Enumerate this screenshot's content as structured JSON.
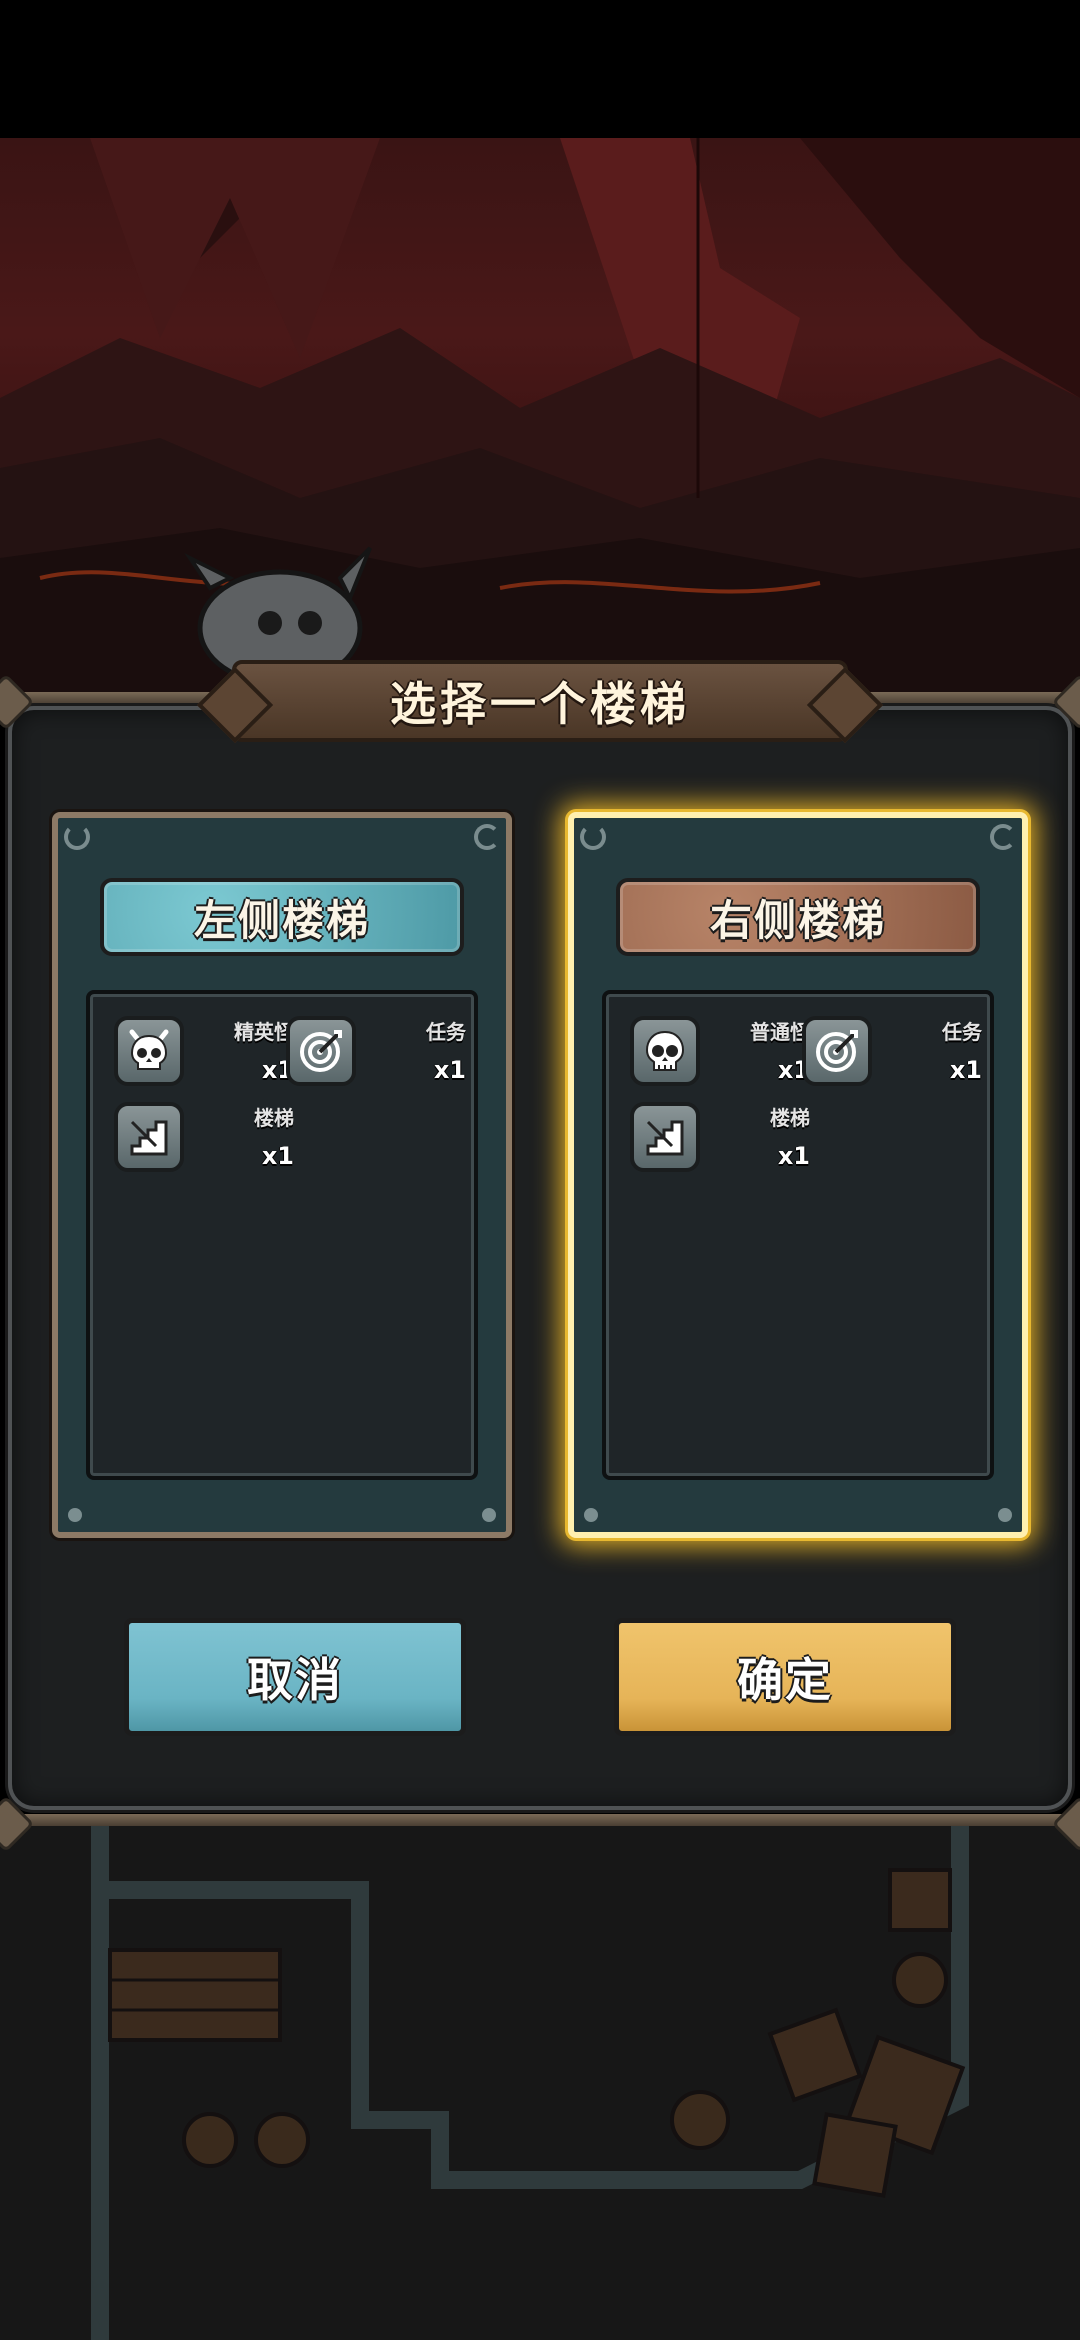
{
  "dialog": {
    "title": "选择一个楼梯",
    "options": [
      {
        "banner": "左侧楼梯",
        "selected": false,
        "banner_color": "#5aa7b2",
        "rewards": [
          {
            "icon": "demon-skull-icon",
            "label": "精英怪",
            "count": "x1"
          },
          {
            "icon": "target-icon",
            "label": "任务",
            "count": "x1"
          },
          {
            "icon": "stairs-icon",
            "label": "楼梯",
            "count": "x1"
          }
        ]
      },
      {
        "banner": "右侧楼梯",
        "selected": true,
        "banner_color": "#a06a50",
        "rewards": [
          {
            "icon": "skull-icon",
            "label": "普通怪",
            "count": "x1"
          },
          {
            "icon": "target-icon",
            "label": "任务",
            "count": "x1"
          },
          {
            "icon": "stairs-icon",
            "label": "楼梯",
            "count": "x1"
          }
        ]
      }
    ],
    "buttons": {
      "cancel": "取消",
      "confirm": "确定"
    }
  },
  "colors": {
    "selected_glow": "#ffc428",
    "cancel_button": "#6ab4c4",
    "confirm_button": "#e6b458"
  }
}
